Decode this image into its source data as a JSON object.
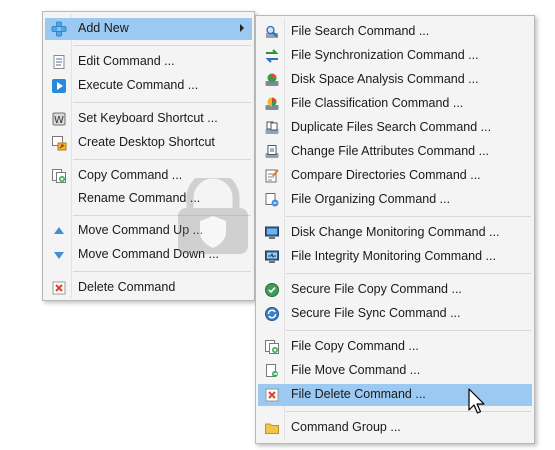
{
  "main_menu": {
    "add_new": "Add New",
    "edit": "Edit Command ...",
    "execute": "Execute Command ...",
    "set_shortcut": "Set Keyboard Shortcut ...",
    "desktop_shortcut": "Create Desktop Shortcut",
    "copy": "Copy Command ...",
    "rename": "Rename Command ...",
    "move_up": "Move Command Up ...",
    "move_down": "Move Command Down ...",
    "delete": "Delete Command"
  },
  "submenu": {
    "file_search": "File Search Command ...",
    "file_sync": "File Synchronization Command ...",
    "disk_space": "Disk Space Analysis Command ...",
    "file_classification": "File Classification Command ...",
    "duplicate_files": "Duplicate Files Search Command ...",
    "change_attributes": "Change File Attributes Command ...",
    "compare_dirs": "Compare Directories Command ...",
    "file_organizing": "File Organizing Command ...",
    "disk_change": "Disk Change Monitoring Command ...",
    "file_integrity": "File Integrity Monitoring Command ...",
    "secure_copy": "Secure File Copy Command ...",
    "secure_sync": "Secure File Sync Command ...",
    "file_copy": "File Copy Command ...",
    "file_move": "File Move Command ...",
    "file_delete": "File Delete Command ...",
    "command_group": "Command Group ..."
  },
  "colors": {
    "highlight": "#9bc9f1",
    "menu_bg": "#f4f4f4",
    "disabled_text": "#8c8c8c"
  },
  "icons": {
    "add_new": "plus-icon",
    "edit": "document-edit-icon",
    "execute": "play-icon",
    "set_shortcut": "keyboard-icon",
    "desktop_shortcut": "desktop-shortcut-icon",
    "copy": "copy-icon",
    "move_up": "triangle-up-icon",
    "move_down": "triangle-down-icon",
    "delete": "delete-icon",
    "command_group": "folder-icon"
  }
}
